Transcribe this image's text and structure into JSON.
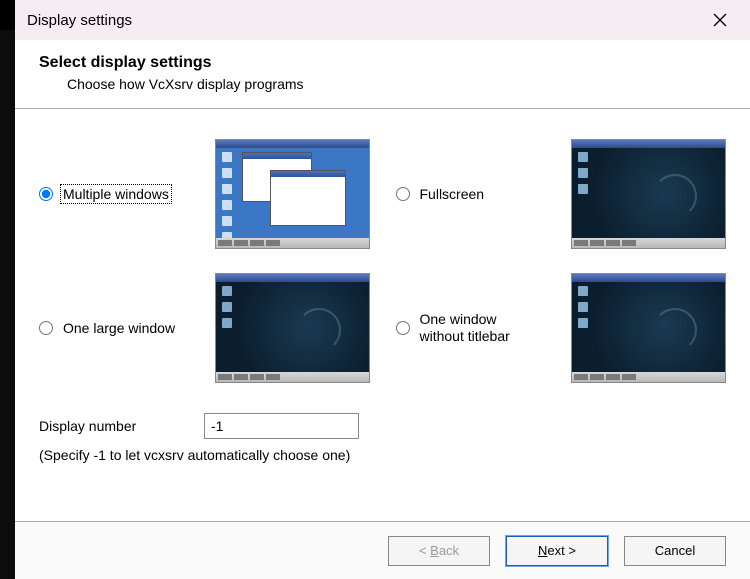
{
  "window": {
    "title": "Display settings"
  },
  "header": {
    "title": "Select display settings",
    "subtitle": "Choose how VcXsrv display programs"
  },
  "options": {
    "multiple_windows": {
      "label": "Multiple windows",
      "selected": true
    },
    "fullscreen": {
      "label": "Fullscreen",
      "selected": false
    },
    "one_large": {
      "label": "One large window",
      "selected": false
    },
    "one_no_titlebar": {
      "label": "One window\nwithout titlebar",
      "selected": false
    }
  },
  "display_number": {
    "label": "Display number",
    "value": "-1",
    "hint": "(Specify -1 to let vcxsrv automatically choose one)"
  },
  "buttons": {
    "back": {
      "label": "Back",
      "prefix": "< ",
      "enabled": false
    },
    "next": {
      "label": "Next",
      "suffix": " >",
      "enabled": true,
      "default": true
    },
    "cancel": {
      "label": "Cancel",
      "enabled": true
    }
  }
}
